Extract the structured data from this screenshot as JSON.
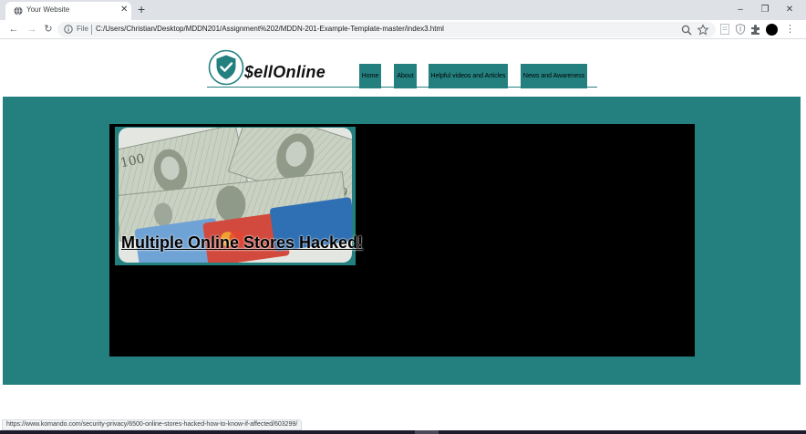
{
  "browser": {
    "tab_title": "Your Website",
    "tab_close": "✕",
    "new_tab": "+",
    "window_controls": {
      "minimize": "–",
      "maximize": "❐",
      "close": "✕"
    },
    "nav": {
      "back": "←",
      "forward": "→",
      "reload": "↻"
    },
    "address_bar": {
      "scheme_label": "File",
      "url": "C:/Users/Christian/Desktop/MDDN201/Assignment%202/MDDN-201-Example-Template-master/index3.html"
    },
    "menu_glyph": "⋮",
    "icons": [
      "info-icon",
      "zoom-icon",
      "bookmark-star-icon",
      "reader-icon",
      "shield-extension-icon",
      "puzzle-extensions-icon",
      "profile-avatar",
      "kebab-menu-icon"
    ],
    "status_url": "https://www.komando.com/security-privacy/6500-online-stores-hacked-how-to-know-if-affected/603299/"
  },
  "site": {
    "logo_text": "$ellOnline",
    "nav_items": [
      "Home",
      "About",
      "Helpful videos and Articles",
      "News and Awareness"
    ],
    "card": {
      "title": "Multiple Online Stores Hacked!",
      "image": "money-and-credit-cards"
    }
  },
  "colors": {
    "accent": "#23807f",
    "panel": "#000000",
    "page_bg": "#ffffff",
    "chrome_bg": "#dee1e6"
  }
}
